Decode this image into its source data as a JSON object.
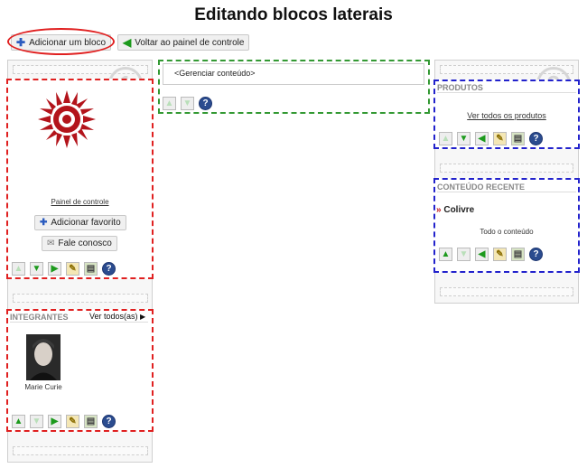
{
  "page": {
    "title": "Editando blocos laterais"
  },
  "toolbar": {
    "add_block": "Adicionar um bloco",
    "back_to_panel": "Voltar ao painel de controle"
  },
  "left_column": {
    "number": "1",
    "user_block": {
      "control_panel_link": "Painel de controle",
      "add_favorite": "Adicionar favorito",
      "contact": "Fale conosco"
    },
    "members_block": {
      "title": "INTEGRANTES",
      "view_all": "Ver todos(as)",
      "member_name": "Marie Curie"
    }
  },
  "center_column": {
    "main_content_label": "<Gerenciar conteúdo>"
  },
  "right_column": {
    "number": "3",
    "products_block": {
      "title": "PRODUTOS",
      "view_all": "Ver todos os produtos"
    },
    "recent_block": {
      "title": "CONTEÚDO RECENTE",
      "item": "Colivre",
      "all_content": "Todo o conteúdo"
    }
  }
}
